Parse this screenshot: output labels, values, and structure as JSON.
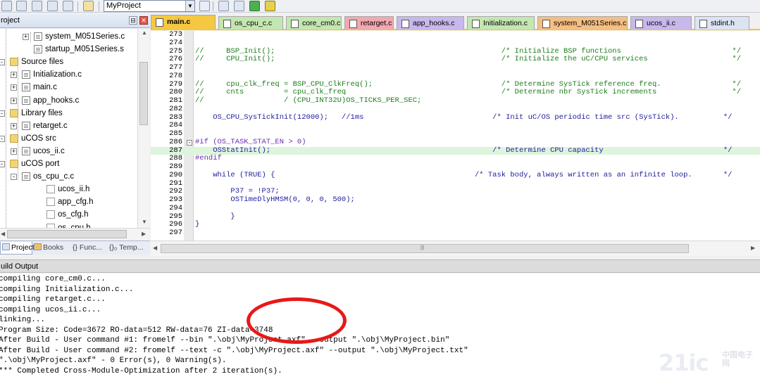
{
  "toolbar": {
    "target": "MyProject",
    "icons": [
      "open-icon",
      "save-icon",
      "save-all-icon",
      "stack-icon",
      "print-icon",
      "load-icon",
      "target-dropdown",
      "wand-icon",
      "options-icon",
      "manage-icon",
      "diamond-icon",
      "batch-icon"
    ]
  },
  "project_panel": {
    "title": "roject",
    "tree": [
      {
        "label": "system_M051Series.c",
        "level": 3,
        "kind": "file",
        "expand": "+"
      },
      {
        "label": "startup_M051Series.s",
        "level": 3,
        "kind": "file",
        "expand": ""
      },
      {
        "label": "Source files",
        "level": 1,
        "kind": "folder",
        "expand": "-"
      },
      {
        "label": "Initialization.c",
        "level": 2,
        "kind": "file",
        "expand": "+"
      },
      {
        "label": "main.c",
        "level": 2,
        "kind": "file",
        "expand": "+"
      },
      {
        "label": "app_hooks.c",
        "level": 2,
        "kind": "file",
        "expand": "+"
      },
      {
        "label": "Library files",
        "level": 1,
        "kind": "folder",
        "expand": "-"
      },
      {
        "label": "retarget.c",
        "level": 2,
        "kind": "file",
        "expand": "+"
      },
      {
        "label": "uCOS src",
        "level": 1,
        "kind": "folder",
        "expand": "-"
      },
      {
        "label": "ucos_ii.c",
        "level": 2,
        "kind": "file",
        "expand": "+"
      },
      {
        "label": "uCOS port",
        "level": 1,
        "kind": "folder",
        "expand": "-"
      },
      {
        "label": "os_cpu_c.c",
        "level": 2,
        "kind": "file",
        "expand": "-"
      },
      {
        "label": "ucos_ii.h",
        "level": 3,
        "kind": "header",
        "expand": ""
      },
      {
        "label": "app_cfg.h",
        "level": 3,
        "kind": "header",
        "expand": ""
      },
      {
        "label": "os_cfg.h",
        "level": 3,
        "kind": "header",
        "expand": ""
      },
      {
        "label": "os_cpu.h",
        "level": 3,
        "kind": "header",
        "expand": ""
      }
    ],
    "tabs": [
      "Project",
      "Books",
      "{} Func...",
      "{}₀ Temp..."
    ]
  },
  "editor_tabs": [
    {
      "label": "main.c",
      "color": "#f5c842",
      "active": true
    },
    {
      "label": "os_cpu_c.c",
      "color": "#c4e6b0"
    },
    {
      "label": "core_cm0.c",
      "color": "#c4e6b0"
    },
    {
      "label": "retarget.c",
      "color": "#f2a8b0"
    },
    {
      "label": "app_hooks.c",
      "color": "#c8b8ec"
    },
    {
      "label": "Initialization.c",
      "color": "#c4e6b0"
    },
    {
      "label": "system_M051Series.c",
      "color": "#f5be82"
    },
    {
      "label": "ucos_ii.c",
      "color": "#c8b8ec"
    },
    {
      "label": "stdint.h",
      "color": "#dce4f2"
    }
  ],
  "code": [
    {
      "ln": "273",
      "t": ""
    },
    {
      "ln": "274",
      "t": ""
    },
    {
      "ln": "275",
      "t": "//     BSP_Init();                                                   /* Initialize BSP functions                         */",
      "c": 1
    },
    {
      "ln": "276",
      "t": "//     CPU_Init();                                                   /* Initialize the uC/CPU services                   */",
      "c": 1
    },
    {
      "ln": "277",
      "t": ""
    },
    {
      "ln": "278",
      "t": ""
    },
    {
      "ln": "279",
      "t": "//     cpu_clk_freq = BSP_CPU_ClkFreq();                             /* Determine SysTick reference freq.                */",
      "c": 1
    },
    {
      "ln": "280",
      "t": "//     cnts         = cpu_clk_freq                                   /* Determine nbr SysTick increments                 */",
      "c": 1
    },
    {
      "ln": "281",
      "t": "//                  / (CPU_INT32U)OS_TICKS_PER_SEC;",
      "c": 1
    },
    {
      "ln": "282",
      "t": ""
    },
    {
      "ln": "283",
      "t": "    OS_CPU_SysTickInit(12000);   //1ms                             /* Init uC/OS periodic time src (SysTick).          */"
    },
    {
      "ln": "284",
      "t": ""
    },
    {
      "ln": "285",
      "t": ""
    },
    {
      "ln": "286",
      "t": "#if (OS_TASK_STAT_EN > 0)",
      "p": 1
    },
    {
      "ln": "287",
      "t": "    OSStatInit();                                                  /* Determine CPU capacity                           */",
      "h": 1
    },
    {
      "ln": "288",
      "t": "#endif",
      "p": 1
    },
    {
      "ln": "289",
      "t": ""
    },
    {
      "ln": "290",
      "t": "    while (TRUE) {                                             /* Task body, always written as an infinite loop.       */"
    },
    {
      "ln": "291",
      "t": ""
    },
    {
      "ln": "292",
      "t": "        P37 = !P37;"
    },
    {
      "ln": "293",
      "t": "        OSTimeDlyHMSM(0, 0, 0, 500);"
    },
    {
      "ln": "294",
      "t": ""
    },
    {
      "ln": "295",
      "t": "        }"
    },
    {
      "ln": "296",
      "t": "}"
    },
    {
      "ln": "297",
      "t": ""
    }
  ],
  "build": {
    "title": "uild Output",
    "lines": [
      "compiling core_cm0.c...",
      "compiling Initialization.c...",
      "compiling retarget.c...",
      "compiling ucos_ii.c...",
      "linking...",
      "Program Size: Code=3672 RO-data=512 RW-data=76 ZI-data=3748",
      "After Build - User command #1: fromelf --bin \".\\obj\\MyProject.axf\" --output \".\\obj\\MyProject.bin\"",
      "After Build - User command #2: fromelf --text -c \".\\obj\\MyProject.axf\" --output \".\\obj\\MyProject.txt\"",
      "\".\\obj\\MyProject.axf\" - 0 Error(s), 0 Warning(s).",
      "*** Completed Cross-Module-Optimization after 2 iteration(s)."
    ]
  },
  "watermark": {
    "main": "21ic",
    "sub": "中国电子网"
  },
  "colors": {
    "highlight": "#dcf5dc",
    "comment": "#1c7c1c",
    "annotation": "#e81818"
  }
}
